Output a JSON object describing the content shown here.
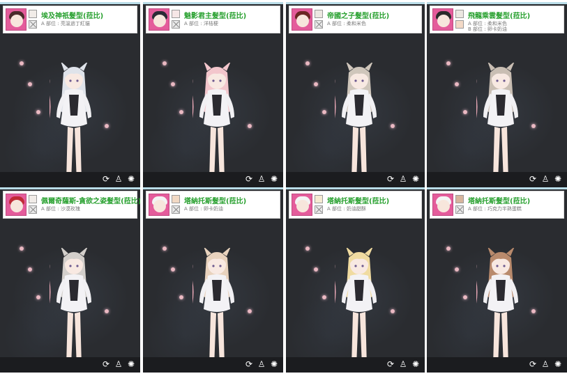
{
  "cards": [
    {
      "title": "埃及神祇髮型(菈比)",
      "part_a": "A 部位 : 亮溫過丁紅貓",
      "part_b": "",
      "hair_color": "#dfe3ea",
      "avatar_hair": "#4a2a2a",
      "avatar_bg": "#e45c9b",
      "swatch_a": "#f1ece8",
      "swatch_b": ""
    },
    {
      "title": "魅影君主髮型(菈比)",
      "part_a": "A 部位 : 洋桔梗",
      "part_b": "",
      "hair_color": "#f3c6cc",
      "avatar_hair": "#2b2b35",
      "avatar_bg": "#e45c9b",
      "swatch_a": "#f6e6e6",
      "swatch_b": ""
    },
    {
      "title": "帝國之子髮型(菈比)",
      "part_a": "A 部位 : 柔和米色",
      "part_b": "",
      "hair_color": "#cfc6bb",
      "avatar_hair": "#6b2624",
      "avatar_bg": "#e45c9b",
      "swatch_a": "#ece7e1",
      "swatch_b": ""
    },
    {
      "title": "飛龍乘雲髮型(菈比)",
      "part_a": "A 部位 : 柔和米色",
      "part_b": "B 部位 : 卵卡奶油",
      "hair_color": "#c9beb3",
      "avatar_hair": "#2a2a2a",
      "avatar_bg": "#e45c9b",
      "swatch_a": "#ece7e1",
      "swatch_b": "#f3d9c6"
    },
    {
      "title": "佩爾奇薩斯-貪欲之姿髮型(菈比)",
      "part_a": "A 部位 : 沙漠玫瑰",
      "part_b": "",
      "hair_color": "#d3cfcb",
      "avatar_hair": "#c02a36",
      "avatar_bg": "#e45c9b",
      "swatch_a": "#f1ece8",
      "swatch_b": ""
    },
    {
      "title": "塔納托斯髮型(菈比)",
      "part_a": "A 部位 : 卵卡奶油",
      "part_b": "",
      "hair_color": "#e8d2bd",
      "avatar_hair": "#f3f3f3",
      "avatar_bg": "#e45c9b",
      "swatch_a": "#f2d9c4",
      "swatch_b": ""
    },
    {
      "title": "塔納托斯髮型(菈比)",
      "part_a": "A 部位 : 奶油甜酥",
      "part_b": "",
      "hair_color": "#f0dba0",
      "avatar_hair": "#f3f3f3",
      "avatar_bg": "#e45c9b",
      "swatch_a": "#f6ebd2",
      "swatch_b": ""
    },
    {
      "title": "塔納托斯髮型(菈比)",
      "part_a": "A 部位 : 巧克力半熟蛋糕",
      "part_b": "",
      "hair_color": "#b98a6c",
      "avatar_hair": "#f3f3f3",
      "avatar_bg": "#e45c9b",
      "swatch_a": "#d7b59d",
      "swatch_b": ""
    }
  ],
  "toolbar_icons": [
    "refresh-icon",
    "person-icon",
    "lightbulb-icon"
  ],
  "colors": {
    "title_green": "#27a02e",
    "panel_bg": "#2a2c30",
    "toolbar_bg": "#1b1c1f",
    "top_accent": "#b9dde8"
  }
}
